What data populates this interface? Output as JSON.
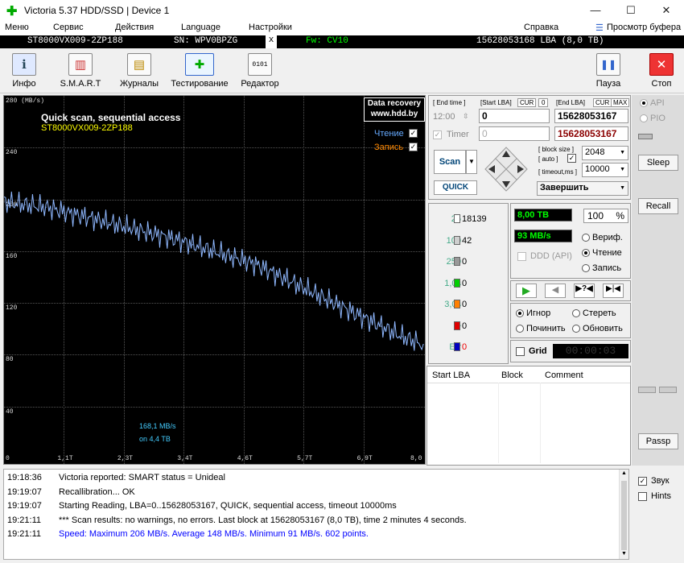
{
  "window": {
    "title": "Victoria 5.37 HDD/SSD | Device 1",
    "min": "—",
    "max": "☐",
    "close": "✕"
  },
  "menu": {
    "items": [
      "Меню",
      "Сервис",
      "Действия",
      "Language",
      "Настройки"
    ],
    "help": "Справка",
    "buffer": "Просмотр буфера"
  },
  "device": {
    "model": "ST8000VX009-2ZP188",
    "serial": "SN: WPV0BPZG",
    "x": "x",
    "fw": "Fw: CV10",
    "lba": "15628053168 LBA (8,0 TB)"
  },
  "toolbar": {
    "info": "Инфо",
    "smart": "S.M.A.R.T",
    "logs": "Журналы",
    "test": "Тестирование",
    "editor": "Редактор",
    "pause": "Пауза",
    "stop": "Стоп"
  },
  "graph": {
    "title": "Quick scan, sequential access",
    "model": "ST8000VX009-2ZP188",
    "y_unit": "280 (MB/s)",
    "recovery1": "Data recovery",
    "recovery2": "www.hdd.by",
    "read": "Чтение",
    "write": "Запись",
    "speed": "168,1 MB/s",
    "pos": "on 4,4 TB"
  },
  "chart_data": {
    "type": "line",
    "ylabel": "MB/s",
    "ylim": [
      0,
      280
    ],
    "xlim": [
      0,
      8.0
    ],
    "yticks": [
      "240",
      "200",
      "160",
      "120",
      "80",
      "40"
    ],
    "xticks": [
      "0",
      "1,1T",
      "2,3T",
      "3,4T",
      "4,6T",
      "5,7T",
      "6,9T",
      "8,0"
    ],
    "series": [
      {
        "name": "Чтение",
        "x": [
          0,
          0.4,
          0.8,
          1.2,
          1.6,
          2.0,
          2.4,
          2.8,
          3.2,
          3.6,
          4.0,
          4.4,
          4.8,
          5.2,
          5.6,
          6.0,
          6.4,
          6.8,
          7.2,
          7.6,
          8.0
        ],
        "values": [
          198,
          196,
          194,
          190,
          186,
          182,
          178,
          174,
          170,
          165,
          160,
          155,
          150,
          142,
          134,
          126,
          118,
          110,
          102,
          94,
          88
        ]
      }
    ]
  },
  "range": {
    "end_time": "[ End time ]",
    "start_lba": "[Start LBA]",
    "cur": "CUR",
    "zero": "0",
    "end_lba": "[End LBA]",
    "max": "MAX",
    "time_val": "12:00",
    "start_val": "0",
    "end_val": "15628053167",
    "timer": "Timer",
    "timer_val": "0",
    "end_val2": "15628053167"
  },
  "scan": {
    "scan": "Scan",
    "quick": "QUICK",
    "block_size": "[ block size ]",
    "auto": "[ auto ]",
    "timeout": "[ timeout,ms ]",
    "bs_val": "2048",
    "to_val": "10000",
    "finish": "Завершить"
  },
  "blocks": [
    {
      "t": "25",
      "n": "18139",
      "c": "#ffffff"
    },
    {
      "t": "100",
      "n": "42",
      "c": "#cfcfcf"
    },
    {
      "t": "250",
      "n": "0",
      "c": "#999999"
    },
    {
      "t": "1,0s",
      "n": "0",
      "c": "#00d000"
    },
    {
      "t": "3,0s",
      "n": "0",
      "c": "#ff8000"
    },
    {
      "t": ">",
      "n": "0",
      "c": "#e00000"
    },
    {
      "t": "Err",
      "n": "0",
      "c": "#0000c0"
    }
  ],
  "status": {
    "size": "8,00 TB",
    "pct": "100",
    "pct_sign": "%",
    "speed": "93 MB/s",
    "ddd": "DDD (API)",
    "verify": "Вериф.",
    "read": "Чтение",
    "write": "Запись"
  },
  "actions": {
    "ignore": "Игнор",
    "erase": "Стереть",
    "repair": "Починить",
    "update": "Обновить",
    "grid": "Grid",
    "clock": "00:00:03"
  },
  "table": {
    "headers": [
      "Start LBA",
      "Block",
      "Comment"
    ]
  },
  "side": {
    "api": "API",
    "pio": "PIO",
    "sleep": "Sleep",
    "recall": "Recall",
    "passp": "Passp"
  },
  "log": [
    {
      "tm": "19:18:36",
      "msg": "Victoria reported: SMART status = Unideal",
      "c": "#000"
    },
    {
      "tm": "19:19:07",
      "msg": "Recallibration... OK",
      "c": "#000"
    },
    {
      "tm": "19:19:07",
      "msg": "Starting Reading, LBA=0..15628053167, QUICK, sequential access, timeout 10000ms",
      "c": "#000"
    },
    {
      "tm": "19:21:11",
      "msg": "*** Scan results: no warnings, no errors. Last block at 15628053167 (8,0 TB), time 2 minutes 4 seconds.",
      "c": "#000"
    },
    {
      "tm": "19:21:11",
      "msg": "Speed: Maximum 206 MB/s. Average 148 MB/s. Minimum 91 MB/s. 602 points.",
      "c": "#0000ff"
    }
  ],
  "logopts": {
    "sound": "Звук",
    "hints": "Hints"
  }
}
